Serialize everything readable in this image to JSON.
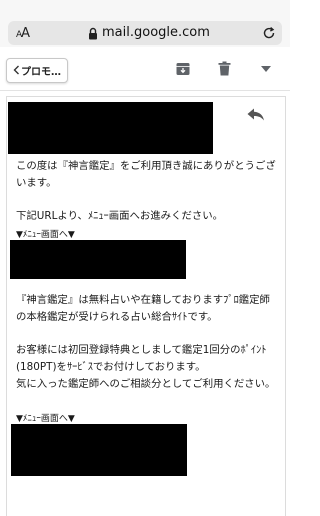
{
  "browser": {
    "text_size_button": "AA",
    "url": "mail.google.com",
    "icons": [
      "lock-icon",
      "reload-icon"
    ]
  },
  "toolbar": {
    "back_label": "プロモ…",
    "icons": [
      "archive-icon",
      "trash-icon",
      "chevron-down-icon"
    ]
  },
  "message": {
    "para1": "この度は『神言鑑定』をご利用頂き誠にありがとうございます。",
    "para2": "下記URLより、ﾒﾆｭｰ画面へお進みください。",
    "menu_link_label_1": "▼ﾒﾆｭｰ画面へ▼",
    "para3": "『神言鑑定』は無料占いや在籍しておりますﾌﾟﾛ鑑定師の本格鑑定が受けられる占い総合ｻｲﾄです。",
    "para4_line1": "お客様には初回登録特典としまして鑑定1回分のﾎﾟｲﾝﾄ(180PT)をｻｰﾋﾞｽでお付けしております。",
    "para4_line2": "気に入った鑑定師へのご相談分としてご利用ください。",
    "menu_link_label_2": "▼ﾒﾆｭｰ画面へ▼"
  }
}
